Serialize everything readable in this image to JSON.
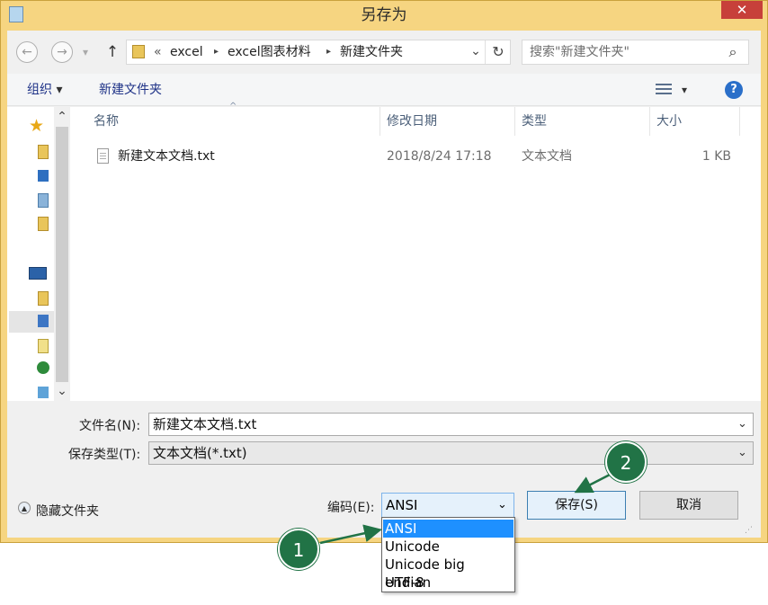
{
  "window": {
    "title": "另存为",
    "close_glyph": "✕"
  },
  "nav": {
    "back_glyph": "←",
    "forward_glyph": "→",
    "dropdown_glyph": "▾",
    "up_glyph": "↑"
  },
  "address": {
    "overflow_glyph": "«",
    "segments": [
      "excel",
      "excel图表材料",
      "新建文件夹"
    ],
    "separator_glyph": "▸",
    "dropdown_glyph": "⌄",
    "refresh_glyph": "↻"
  },
  "search": {
    "placeholder": "搜索\"新建文件夹\"",
    "icon_glyph": "⌕"
  },
  "toolbar": {
    "organize_label": "组织",
    "organize_arrow": "▾",
    "new_folder_label": "新建文件夹",
    "view_arrow": "▾",
    "help_glyph": "?"
  },
  "file_list": {
    "columns": [
      "名称",
      "修改日期",
      "类型",
      "大小"
    ],
    "sort_glyph": "^",
    "rows": [
      {
        "name": "新建文本文档.txt",
        "modified": "2018/8/24 17:18",
        "type": "文本文档",
        "size": "1 KB"
      }
    ]
  },
  "scroll": {
    "up_glyph": "⌃",
    "down_glyph": "⌄"
  },
  "form": {
    "filename_label": "文件名(N):",
    "filename_value": "新建文本文档.txt",
    "filetype_label": "保存类型(T):",
    "filetype_value": "文本文档(*.txt)",
    "combo_arrow": "⌄"
  },
  "footer": {
    "hide_folders_label": "隐藏文件夹",
    "encoding_label": "编码(E):",
    "encoding_value": "ANSI",
    "encoding_options": [
      "ANSI",
      "Unicode",
      "Unicode big endian",
      "UTF-8"
    ],
    "save_label": "保存(S)",
    "cancel_label": "取消"
  },
  "annotations": {
    "step1": "1",
    "step2": "2"
  },
  "colors": {
    "accent": "#217346",
    "selection": "#1e90ff",
    "window_frame": "#f6d581",
    "close": "#c7403a"
  }
}
